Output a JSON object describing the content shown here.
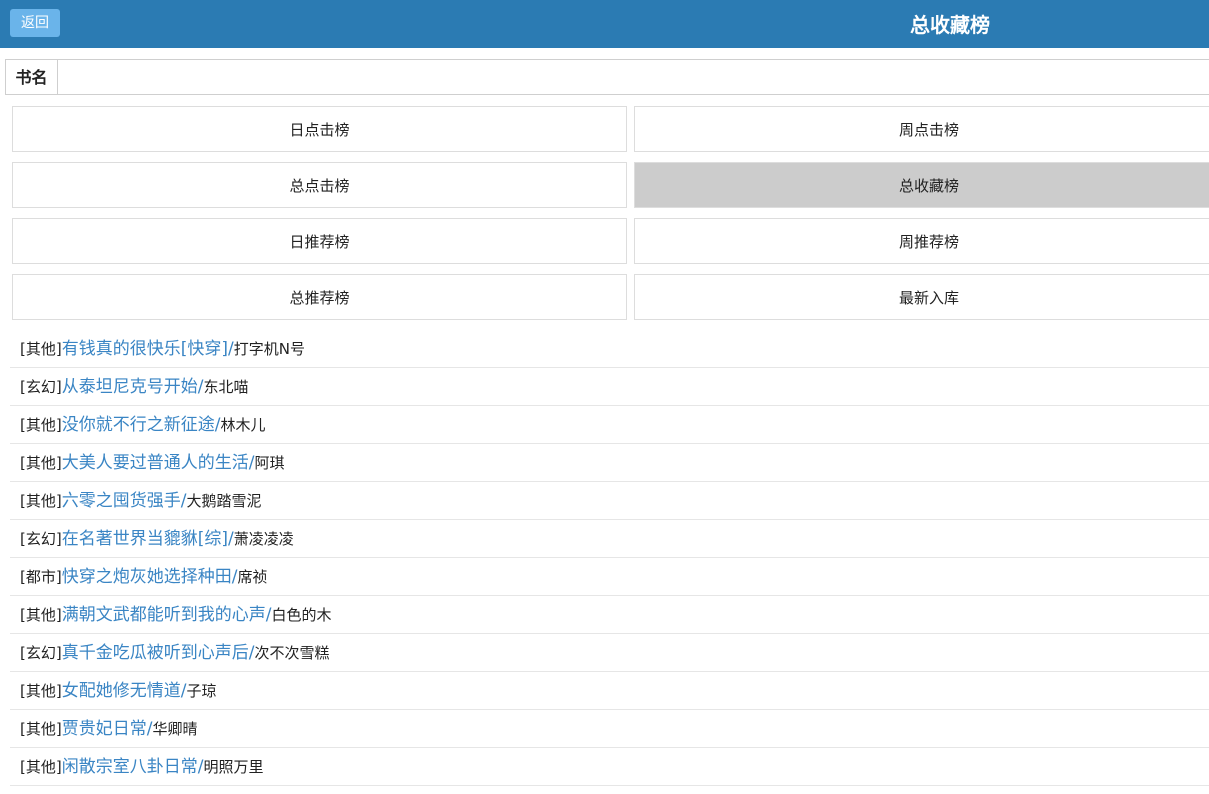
{
  "header": {
    "back_label": "返回",
    "title": "总收藏榜"
  },
  "search": {
    "label": "书名",
    "value": "",
    "placeholder": ""
  },
  "rank_tabs": [
    {
      "label": "日点击榜",
      "active": false
    },
    {
      "label": "周点击榜",
      "active": false
    },
    {
      "label": "总点击榜",
      "active": false
    },
    {
      "label": "总收藏榜",
      "active": true
    },
    {
      "label": "日推荐榜",
      "active": false
    },
    {
      "label": "周推荐榜",
      "active": false
    },
    {
      "label": "总推荐榜",
      "active": false
    },
    {
      "label": "最新入库",
      "active": false
    }
  ],
  "books": [
    {
      "category": "[其他]",
      "title": "有钱真的很快乐[快穿]",
      "author": "打字机N号"
    },
    {
      "category": "[玄幻]",
      "title": "从泰坦尼克号开始",
      "author": "东北喵"
    },
    {
      "category": "[其他]",
      "title": "没你就不行之新征途",
      "author": "林木儿"
    },
    {
      "category": "[其他]",
      "title": "大美人要过普通人的生活",
      "author": "阿琪"
    },
    {
      "category": "[其他]",
      "title": "六零之囤货强手",
      "author": "大鹅踏雪泥"
    },
    {
      "category": "[玄幻]",
      "title": "在名著世界当貔貅[综]",
      "author": "萧凌凌凌"
    },
    {
      "category": "[都市]",
      "title": "快穿之炮灰她选择种田",
      "author": "席祯"
    },
    {
      "category": "[其他]",
      "title": "满朝文武都能听到我的心声",
      "author": "白色的木"
    },
    {
      "category": "[玄幻]",
      "title": "真千金吃瓜被听到心声后",
      "author": "次不次雪糕"
    },
    {
      "category": "[其他]",
      "title": "女配她修无情道",
      "author": "子琼"
    },
    {
      "category": "[其他]",
      "title": "贾贵妃日常",
      "author": "华卿晴"
    },
    {
      "category": "[其他]",
      "title": "闲散宗室八卦日常",
      "author": "明照万里"
    }
  ],
  "separator": "/"
}
